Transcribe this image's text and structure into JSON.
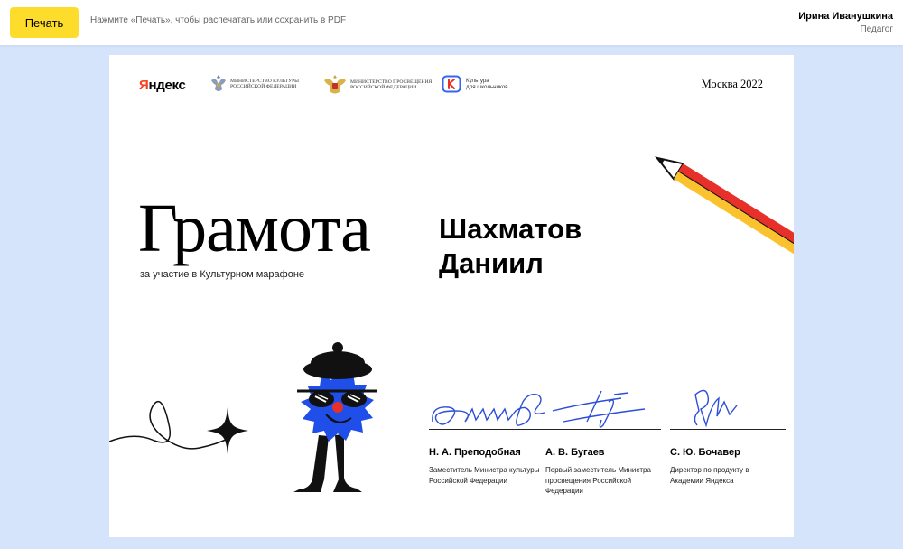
{
  "toolbar": {
    "print_label": "Печать",
    "hint": "Нажмите «Печать», чтобы распечатать или сохранить в PDF"
  },
  "user": {
    "name": "Ирина Иванушкина",
    "role": "Педагог"
  },
  "certificate": {
    "logos": {
      "yandex_first": "Я",
      "yandex_rest": "ндекс",
      "ministry_culture": [
        "Министерство культуры",
        "Российской Федерации"
      ],
      "ministry_education": [
        "Министерство просвещения",
        "Российской Федерации"
      ],
      "culture_kids": [
        "Культура",
        "для школьников"
      ]
    },
    "city_year": "Москва 2022",
    "title": "Грамота",
    "subtitle": "за участие в Культурном марафоне",
    "recipient": [
      "Шахматов",
      "Даниил"
    ],
    "signers": [
      {
        "name": "Н. А. Преподобная",
        "position": "Заместитель Министра культуры Российской Федерации"
      },
      {
        "name": "А. В. Бугаев",
        "position": "Первый заместитель Министра просвещения Российской Федерации"
      },
      {
        "name": "С. Ю. Бочавер",
        "position": "Директор по продукту в Академии Яндекса"
      }
    ]
  },
  "colors": {
    "print_button": "#fddc2b",
    "background": "#d5e4fb",
    "mascot_blue": "#1f4ee8",
    "signature_ink": "#2d4ed8",
    "pencil_red": "#e8302a",
    "pencil_yellow": "#fbc22f",
    "yandex_red": "#fc3f1d"
  }
}
